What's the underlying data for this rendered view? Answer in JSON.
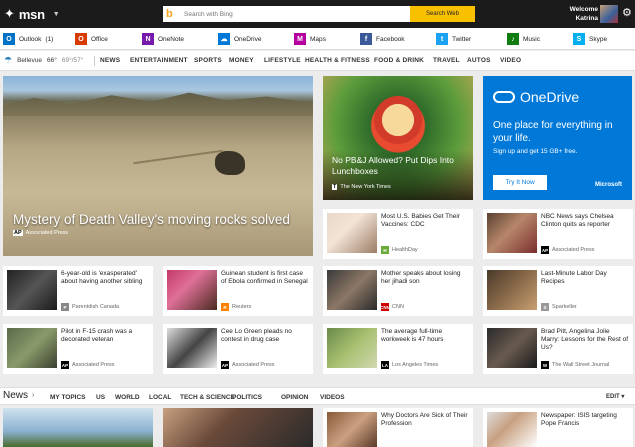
{
  "header": {
    "logo_text": "msn",
    "search_placeholder": "Search with Bing",
    "search_button": "Search Web",
    "welcome_line1": "Welcome",
    "welcome_line2": "Katrina"
  },
  "apps": [
    {
      "label": "Outlook",
      "badge": "(1)",
      "color": "#0072c6",
      "letter": "O"
    },
    {
      "label": "Office",
      "badge": "",
      "color": "#d83b01",
      "letter": "O"
    },
    {
      "label": "OneNote",
      "badge": "",
      "color": "#7719aa",
      "letter": "N"
    },
    {
      "label": "OneDrive",
      "badge": "",
      "color": "#0078d7",
      "letter": "☁"
    },
    {
      "label": "Maps",
      "badge": "",
      "color": "#b4009e",
      "letter": "M"
    },
    {
      "label": "Facebook",
      "badge": "",
      "color": "#3b5998",
      "letter": "f"
    },
    {
      "label": "Twitter",
      "badge": "",
      "color": "#1da1f2",
      "letter": "t"
    },
    {
      "label": "Music",
      "badge": "",
      "color": "#107c10",
      "letter": "♪"
    },
    {
      "label": "Skype",
      "badge": "",
      "color": "#00aff0",
      "letter": "S"
    }
  ],
  "weather": {
    "city": "Bellevue",
    "temp": "66°",
    "range": "69°/57°"
  },
  "nav": [
    "NEWS",
    "ENTERTAINMENT",
    "SPORTS",
    "MONEY",
    "LIFESTYLE",
    "HEALTH & FITNESS",
    "FOOD & DRINK",
    "TRAVEL",
    "AUTOS",
    "VIDEO"
  ],
  "hero": {
    "title": "Mystery of Death Valley's moving rocks solved",
    "source": "Associated Press",
    "badge": "AP"
  },
  "food": {
    "title": "No PB&J Allowed? Put Dips Into Lunchboxes",
    "source": "The New York Times",
    "badge": "T"
  },
  "ad": {
    "brand": "OneDrive",
    "line1": "One place for everything in your life.",
    "line2": "Sign up and get 15 GB+ free.",
    "button": "Try It Now",
    "company": "Microsoft"
  },
  "stories": [
    {
      "title": "Most U.S. Babies Get Their Vaccines: CDC",
      "source": "HealthDay",
      "badge": "H",
      "badge_color": "#6aaa3a",
      "thumb": "linear-gradient(135deg,#e8d8c8,#f2e4d6 40%,#9c7d66)"
    },
    {
      "title": "NBC News says Chelsea Clinton quits as reporter",
      "source": "Associated Press",
      "badge": "AP",
      "badge_color": "#000",
      "thumb": "linear-gradient(135deg,#5a4030,#b7876a 45%,#7a2d2d)"
    },
    {
      "title": "6-year-old is 'exasperated' about having another sibling",
      "source": "Parentdish Canada",
      "badge": "P",
      "badge_color": "#888",
      "thumb": "linear-gradient(135deg,#222,#555 50%,#1a1a1a)"
    },
    {
      "title": "Guinean student is first case of Ebola confirmed in Senegal",
      "source": "Reuters",
      "badge": "R",
      "badge_color": "#ff8000",
      "thumb": "linear-gradient(135deg,#c23a6a,#e07098 40%,#4a2a20)"
    },
    {
      "title": "Mother speaks about losing her jihadi son",
      "source": "CNN",
      "badge": "CNN",
      "badge_color": "#c00",
      "thumb": "linear-gradient(135deg,#3a3a3a,#8c7766 50%,#2a2a2a)"
    },
    {
      "title": "Last-Minute Labor Day Recipes",
      "source": "Sparkeller",
      "badge": "S",
      "badge_color": "#999",
      "thumb": "linear-gradient(135deg,#4a3a2a,#8a6a4a 50%,#c8a070)"
    },
    {
      "title": "Pilot in F-15 crash was a decorated veteran",
      "source": "Associated Press",
      "badge": "AP",
      "badge_color": "#000",
      "thumb": "linear-gradient(135deg,#5a6a4a,#8a9a6a 50%,#3a4030)"
    },
    {
      "title": "Cee Lo Green pleads no contest in drug case",
      "source": "Associated Press",
      "badge": "AP",
      "badge_color": "#000",
      "thumb": "linear-gradient(135deg,#ddd,#444 50%,#eee)"
    },
    {
      "title": "The average full-time workweek is 47 hours",
      "source": "Los Angeles Times",
      "badge": "LA",
      "badge_color": "#000",
      "thumb": "linear-gradient(135deg,#6a8a4a,#a8c070 50%,#d0d8b0)"
    },
    {
      "title": "Brad Pitt, Angelina Jolie Marry: Lessons for the Rest of Us?",
      "source": "The Wall Street Journal",
      "badge": "W",
      "badge_color": "#000",
      "thumb": "linear-gradient(135deg,#2a2a2a,#6a5a50 50%,#1a1a1a)"
    }
  ],
  "news": {
    "label": "News",
    "items": [
      "MY TOPICS",
      "US",
      "WORLD",
      "LOCAL",
      "TECH & SCIENCE",
      "POLITICS",
      "OPINION",
      "VIDEOS"
    ],
    "edit": "EDIT"
  },
  "bottom": [
    {
      "title": "Why Doctors Are Sick of Their Profession",
      "source": "",
      "thumb": "linear-gradient(135deg,#8a5a3a,#caa080 50%,#5a3a2a)"
    },
    {
      "title": "Newspaper: ISIS targeting Pope Francis",
      "source": "",
      "thumb": "linear-gradient(135deg,#ddd,#c8a080 40%,#fff)"
    }
  ]
}
